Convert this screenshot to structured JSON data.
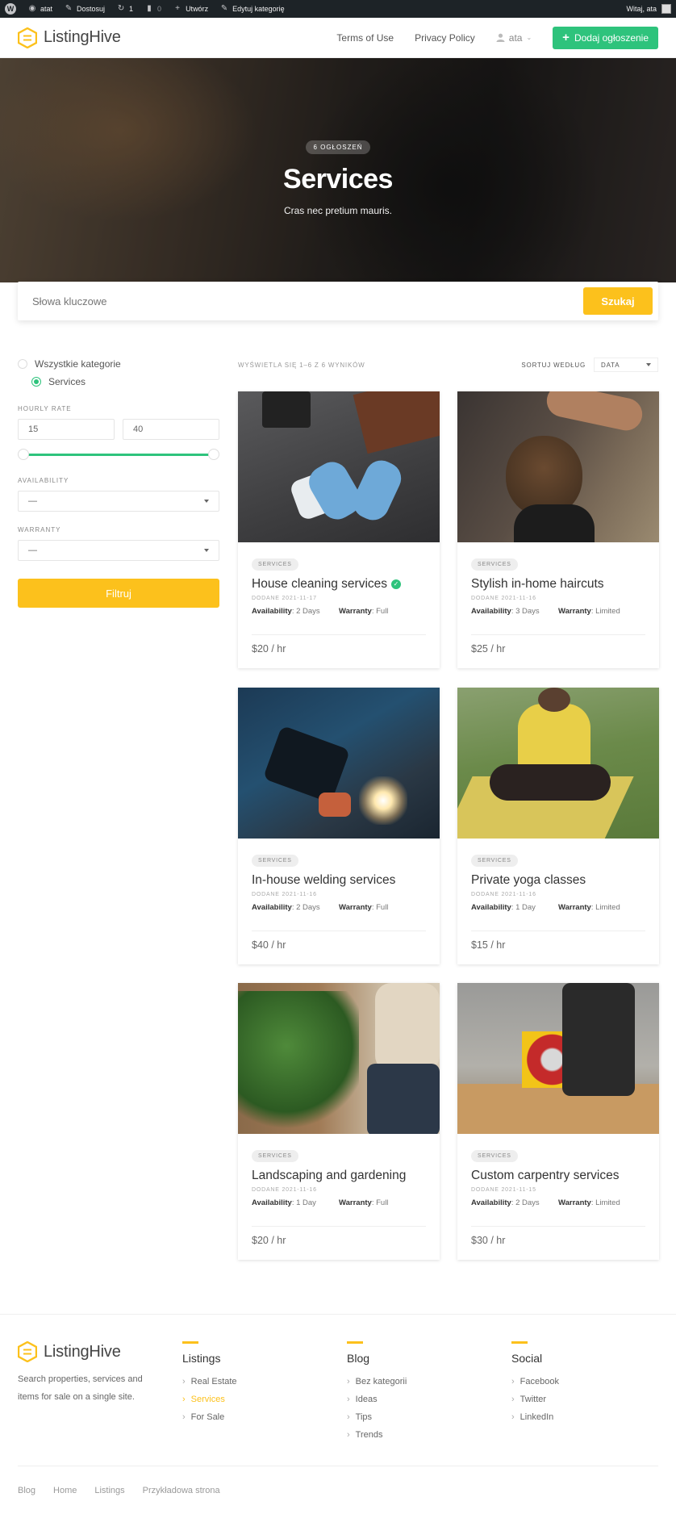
{
  "adminbar": {
    "site_name": "atat",
    "customize": "Dostosuj",
    "updates_count": "1",
    "comments_count": "0",
    "new": "Utwórz",
    "edit_category": "Edytuj kategorię",
    "greeting": "Witaj, ata"
  },
  "header": {
    "logo_text": "ListingHive",
    "nav": [
      "Terms of Use",
      "Privacy Policy"
    ],
    "user": "ata",
    "add_button": "Dodaj ogłoszenie"
  },
  "hero": {
    "count_label": "6 OGŁOSZEŃ",
    "title": "Services",
    "subtitle": "Cras nec pretium mauris."
  },
  "search": {
    "placeholder": "Słowa kluczowe",
    "button": "Szukaj"
  },
  "filters": {
    "categories": [
      {
        "label": "Wszystkie kategorie",
        "selected": false
      },
      {
        "label": "Services",
        "selected": true
      }
    ],
    "hourly_rate_label": "HOURLY RATE",
    "rate_min": "15",
    "rate_max": "40",
    "availability_label": "AVAILABILITY",
    "availability_value": "—",
    "warranty_label": "WARRANTY",
    "warranty_value": "—",
    "filter_button": "Filtruj"
  },
  "results": {
    "summary": "WYŚWIETLA SIĘ 1–6 Z 6 WYNIKÓW",
    "sort_label": "SORTUJ WEDŁUG",
    "sort_value": "DATA"
  },
  "listings": [
    {
      "category": "SERVICES",
      "title": "House cleaning services",
      "verified": true,
      "date": "DODANE 2021-11-17",
      "availability_label": "Availability",
      "availability": "2 Days",
      "warranty_label": "Warranty",
      "warranty": "Full",
      "price": "$20 / hr"
    },
    {
      "category": "SERVICES",
      "title": "Stylish in-home haircuts",
      "verified": false,
      "date": "DODANE 2021-11-16",
      "availability_label": "Availability",
      "availability": "3 Days",
      "warranty_label": "Warranty",
      "warranty": "Limited",
      "price": "$25 / hr"
    },
    {
      "category": "SERVICES",
      "title": "In-house welding services",
      "verified": false,
      "date": "DODANE 2021-11-16",
      "availability_label": "Availability",
      "availability": "2 Days",
      "warranty_label": "Warranty",
      "warranty": "Full",
      "price": "$40 / hr"
    },
    {
      "category": "SERVICES",
      "title": "Private yoga classes",
      "verified": false,
      "date": "DODANE 2021-11-16",
      "availability_label": "Availability",
      "availability": "1 Day",
      "warranty_label": "Warranty",
      "warranty": "Limited",
      "price": "$15 / hr"
    },
    {
      "category": "SERVICES",
      "title": "Landscaping and gardening",
      "verified": false,
      "date": "DODANE 2021-11-16",
      "availability_label": "Availability",
      "availability": "1 Day",
      "warranty_label": "Warranty",
      "warranty": "Full",
      "price": "$20 / hr"
    },
    {
      "category": "SERVICES",
      "title": "Custom carpentry services",
      "verified": false,
      "date": "DODANE 2021-11-15",
      "availability_label": "Availability",
      "availability": "2 Days",
      "warranty_label": "Warranty",
      "warranty": "Limited",
      "price": "$30 / hr"
    }
  ],
  "footer": {
    "logo_text": "ListingHive",
    "description": "Search properties, services and items for sale on a single site.",
    "columns": [
      {
        "title": "Listings",
        "links": [
          "Real Estate",
          "Services",
          "For Sale"
        ],
        "active_index": 1
      },
      {
        "title": "Blog",
        "links": [
          "Bez kategorii",
          "Ideas",
          "Tips",
          "Trends"
        ],
        "active_index": -1
      },
      {
        "title": "Social",
        "links": [
          "Facebook",
          "Twitter",
          "LinkedIn"
        ],
        "active_index": -1
      }
    ],
    "bottom_links": [
      "Blog",
      "Home",
      "Listings",
      "Przykładowa strona"
    ]
  },
  "colors": {
    "accent": "#fcc11c",
    "green": "#2ec37c",
    "adminbar": "#1d2327"
  }
}
